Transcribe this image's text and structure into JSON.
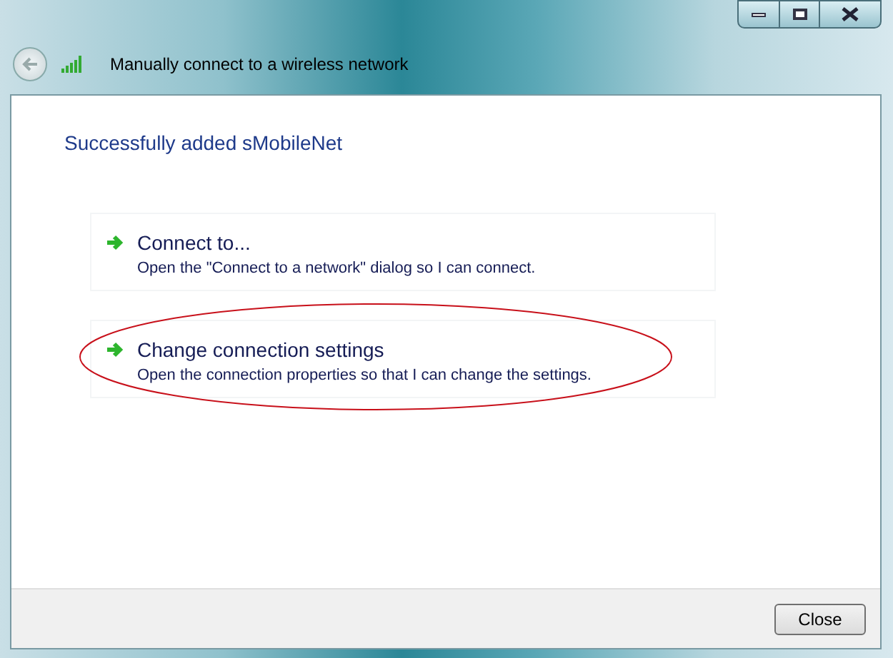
{
  "window": {
    "title": "Manually connect to a wireless network"
  },
  "heading": "Successfully added sMobileNet",
  "options": [
    {
      "title": "Connect to...",
      "description": "Open the \"Connect to a network\" dialog so I can connect.",
      "circled": false
    },
    {
      "title": "Change connection settings",
      "description": "Open the connection properties so that I can change the settings.",
      "circled": true
    }
  ],
  "buttons": [
    "Close"
  ]
}
